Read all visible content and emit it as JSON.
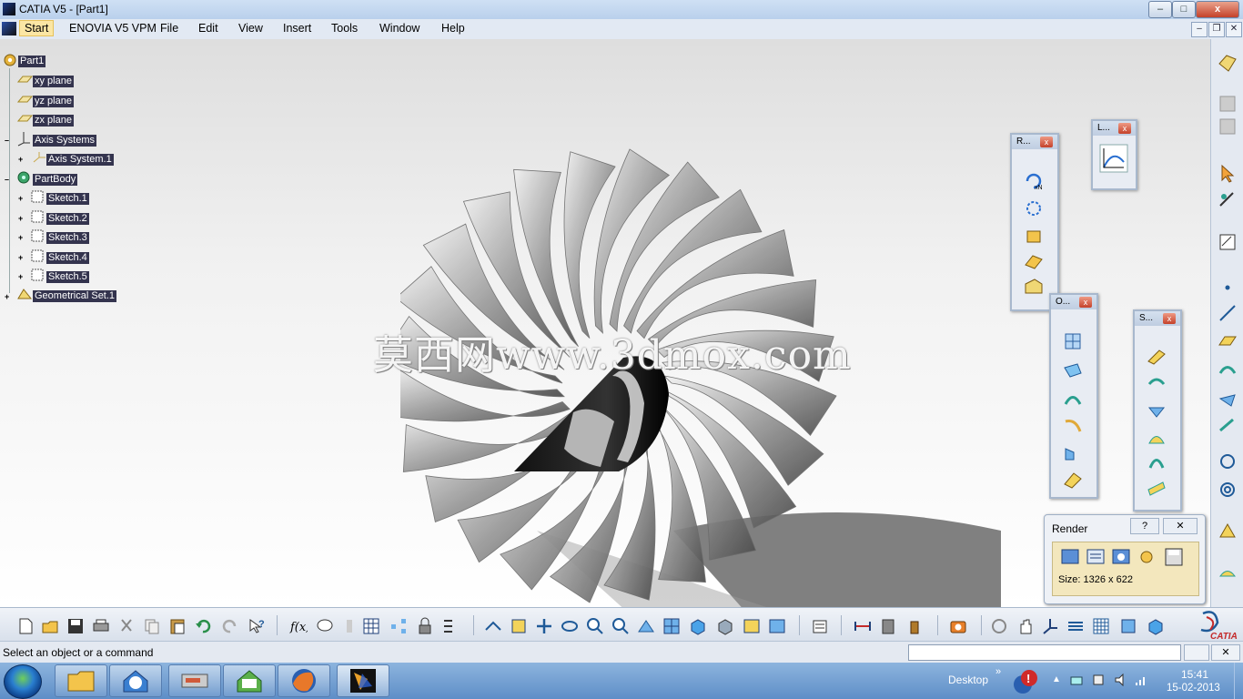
{
  "window": {
    "title": "CATIA V5 - [Part1]",
    "controls": {
      "minimize": "–",
      "maximize": "□",
      "close": "x"
    },
    "mdi_controls": {
      "minimize": "–",
      "restore": "❐",
      "close": "✕"
    }
  },
  "menu": {
    "items": [
      "Start",
      "ENOVIA V5 VPM",
      "File",
      "Edit",
      "View",
      "Insert",
      "Tools",
      "Window",
      "Help"
    ]
  },
  "tree": {
    "root": "Part1",
    "nodes": [
      "xy plane",
      "yz plane",
      "zx plane",
      "Axis Systems",
      "Axis System.1",
      "PartBody",
      "Sketch.1",
      "Sketch.2",
      "Sketch.3",
      "Sketch.4",
      "Sketch.5",
      "Geometrical Set.1"
    ],
    "expand_symbol": "+"
  },
  "watermark": "莫西网www.3dmox.com",
  "floating_toolbars": {
    "r": {
      "title": "R...",
      "close": "x"
    },
    "l": {
      "title": "L...",
      "close": "x"
    },
    "o": {
      "title": "O...",
      "close": "x"
    },
    "s": {
      "title": "S...",
      "close": "x"
    }
  },
  "render_panel": {
    "title": "Render",
    "help": "?",
    "close": "✕",
    "size_label": "Size: 1326 x 622"
  },
  "catia_logo": "CATIA",
  "status": {
    "message": "Select an object or a command",
    "command_input": ""
  },
  "taskbar": {
    "desktop_label": "Desktop",
    "time": "15:41",
    "date": "15-02-2013"
  },
  "colors": {
    "tree_highlight": "#34344e",
    "title_bar": "#b9d0ec",
    "taskbar": "#5e8ec7",
    "close_button": "#c4412a"
  },
  "icons": [
    "catia-app-icon",
    "file-new-icon",
    "open-icon",
    "save-icon",
    "print-icon",
    "cut-icon",
    "copy-icon",
    "paste-icon",
    "undo-icon",
    "redo-icon",
    "whats-this-icon",
    "formula-icon",
    "fit-all-icon",
    "pan-icon",
    "rotate-icon",
    "zoom-in-icon",
    "zoom-out-icon",
    "normal-view-icon",
    "iso-view-icon",
    "shading-icon",
    "hide-show-icon",
    "swap-icon",
    "capture-icon",
    "dassault-logo-icon"
  ]
}
